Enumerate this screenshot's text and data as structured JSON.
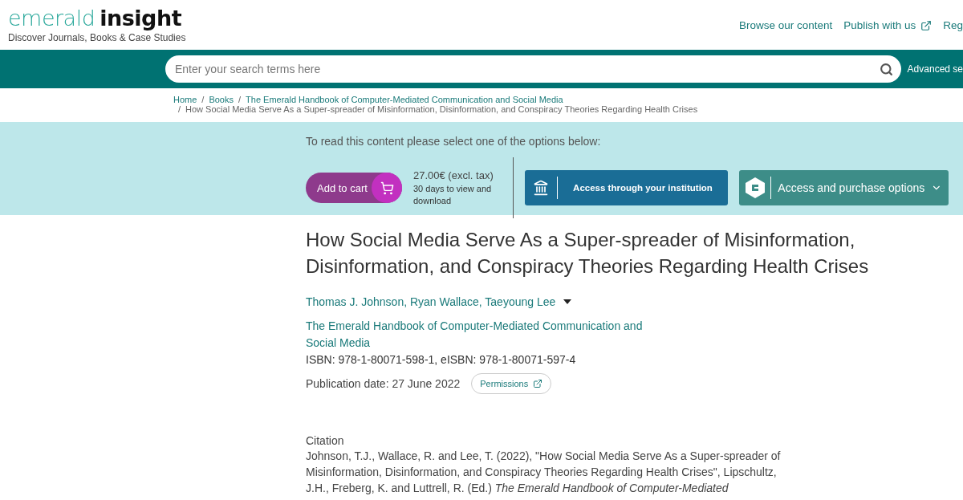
{
  "logo": {
    "light": "emerald",
    "bold": "insight",
    "tagline": "Discover Journals, Books & Case Studies"
  },
  "top_nav": [
    {
      "label": "Browse our content",
      "external": false
    },
    {
      "label": "Publish with us",
      "external": true
    },
    {
      "label": "Reg",
      "external": false
    }
  ],
  "search": {
    "placeholder": "Enter your search terms here",
    "advanced": "Advanced se"
  },
  "breadcrumb": {
    "separator": "/",
    "links": [
      "Home",
      "Books",
      "The Emerald Handbook of Computer-Mediated Communication and Social Media"
    ],
    "current": "How Social Media Serve As a Super-spreader of Misinformation, Disinformation, and Conspiracy Theories Regarding Health Crises"
  },
  "access": {
    "prompt": "To read this content please select one of the options below:",
    "cart_label": "Add to cart",
    "price": "27.00€ (excl. tax)",
    "price_note": "30 days to view and download",
    "institution": "Access through your institution",
    "purchase": "Access and purchase options"
  },
  "chapter": {
    "title": "How Social Media Serve As a Super-spreader of Misinformation, Disinformation, and Conspiracy Theories Regarding Health Crises",
    "authors": "Thomas J. Johnson, Ryan Wallace, Taeyoung Lee",
    "authors_expanded": false,
    "book": "The Emerald Handbook of Computer-Mediated Communication and Social Media",
    "isbn": "ISBN: 978-1-80071-598-1, eISBN: 978-1-80071-597-4",
    "pub_date": "Publication date: 27 June 2022",
    "permissions": "Permissions"
  },
  "citation": {
    "heading": "Citation",
    "text": "Johnson, T.J., Wallace, R. and Lee, T. (2022), \"How Social Media Serve As a Super-spreader of Misinformation, Disinformation, and Conspiracy Theories Regarding Health Crises\", Lipschultz, J.H., Freberg, K. and Luttrell, R. (Ed.) *The Emerald Handbook of Computer-Mediated*"
  }
}
